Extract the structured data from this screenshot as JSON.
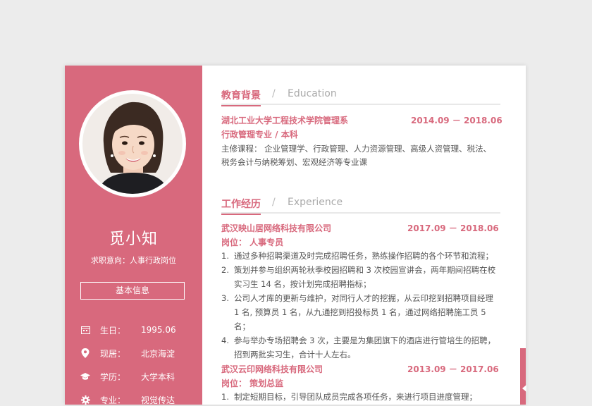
{
  "profile": {
    "name": "觅小知",
    "objective": "求职意向：人事行政岗位",
    "basic_info_label": "基本信息",
    "info": [
      {
        "icon": "calendar-icon",
        "label": "生日：",
        "value": "1995.06"
      },
      {
        "icon": "location-icon",
        "label": "现居：",
        "value": "北京海淀"
      },
      {
        "icon": "graduation-cap-icon",
        "label": "学历：",
        "value": "大学本科"
      },
      {
        "icon": "gear-icon",
        "label": "专业：",
        "value": "视觉传达"
      }
    ]
  },
  "education": {
    "title_cn": "教育背景",
    "separator": "/",
    "title_en": "Education",
    "school": "湖北工业大学工程技术学院管理系",
    "period": "2014.09 － 2018.06",
    "major": "行政管理专业 / 本科",
    "courses_line1": "主修课程：  企业管理学、行政管理、人力资源管理、高级人资管理、税法、",
    "courses_line2": "税务会计与纳税筹划、宏观经济等专业课"
  },
  "experience": {
    "title_cn": "工作经历",
    "separator": "/",
    "title_en": "Experience",
    "jobs": [
      {
        "company": "武汉映山居网络科技有限公司",
        "period": "2017.09 － 2018.06",
        "position": "岗位：  人事专员",
        "items": [
          {
            "num": "1.",
            "lines": [
              "通过多种招聘渠道及时完成招聘任务，熟练操作招聘的各个环节和流程；"
            ]
          },
          {
            "num": "2.",
            "lines": [
              "策划并参与组织两轮秋季校园招聘和 3 次校园宣讲会，两年期间招聘在校",
              "实习生 14 名，按计划完成招聘指标；"
            ]
          },
          {
            "num": "3.",
            "lines": [
              "公司人才库的更新与维护，对同行人才的挖掘，从云印挖到招聘项目经理",
              "1 名, 预算员 1 名，从九通挖到招投标员 1 名，通过网络招聘施工员 5 名；"
            ]
          },
          {
            "num": "4.",
            "lines": [
              "参与举办专场招聘会 3 次，主要是为集团旗下的酒店进行管培生的招聘，",
              "招到两批实习生，合计十人左右。"
            ]
          }
        ]
      },
      {
        "company": "武汉云印网络科技有限公司",
        "period": "2013.09 － 2017.06",
        "position": "岗位：  策划总监",
        "items": [
          {
            "num": "1.",
            "lines": [
              "制定短期目标，引导团队成员完成各项任务，来进行项目进度管理；"
            ]
          }
        ]
      }
    ]
  },
  "colors": {
    "accent": "#d8697d",
    "background": "#ececec",
    "text": "#555555"
  }
}
